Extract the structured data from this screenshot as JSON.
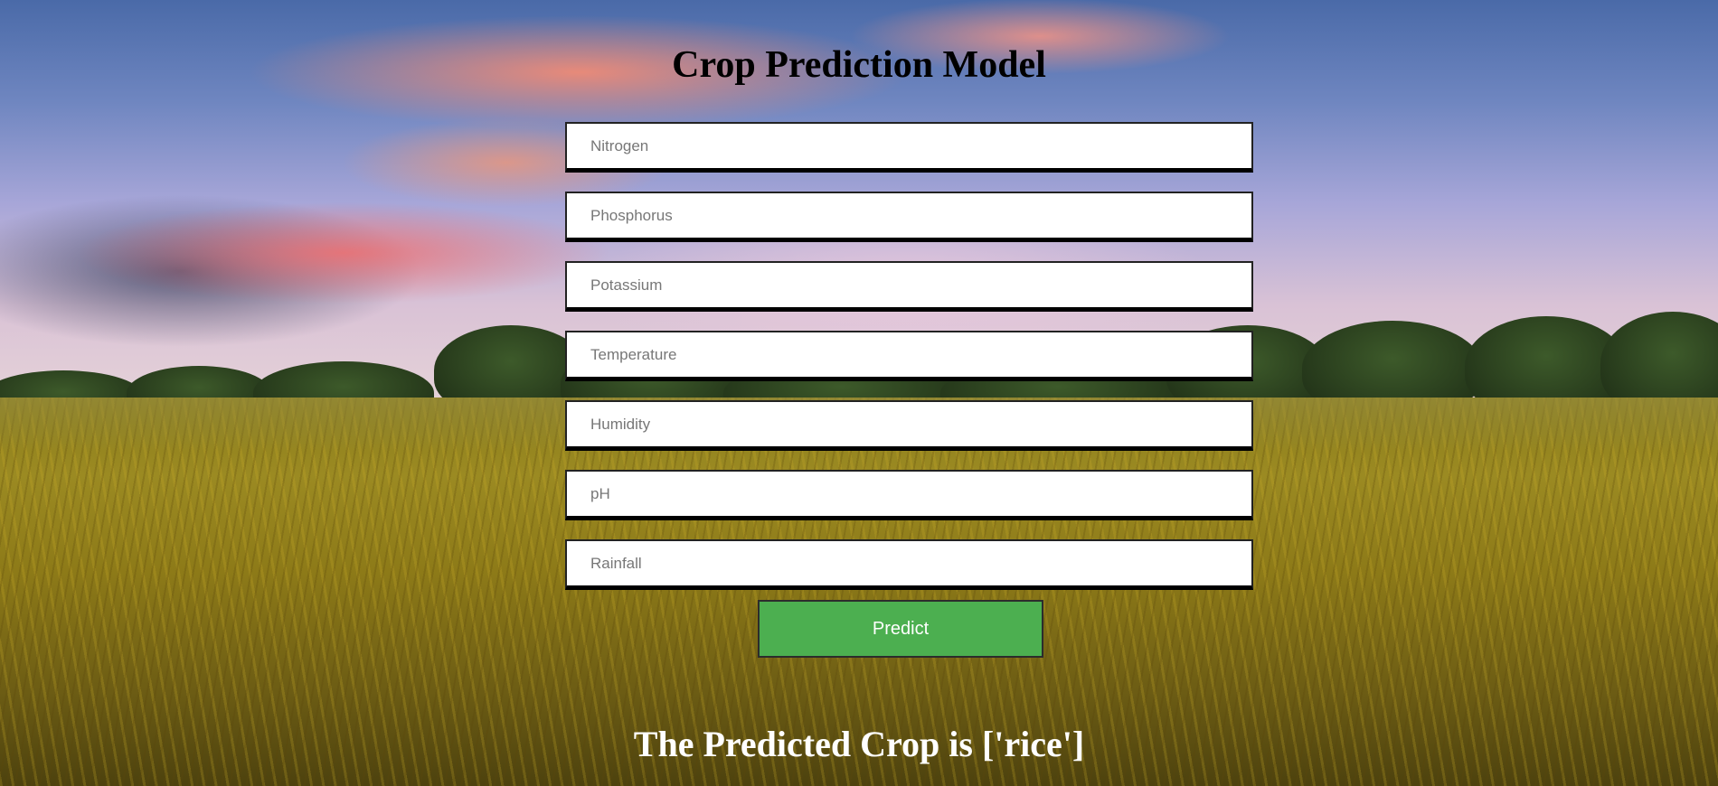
{
  "page": {
    "title": "Crop Prediction Model"
  },
  "form": {
    "fields": [
      {
        "name": "nitrogen-input",
        "placeholder": "Nitrogen",
        "value": ""
      },
      {
        "name": "phosphorus-input",
        "placeholder": "Phosphorus",
        "value": ""
      },
      {
        "name": "potassium-input",
        "placeholder": "Potassium",
        "value": ""
      },
      {
        "name": "temperature-input",
        "placeholder": "Temperature",
        "value": ""
      },
      {
        "name": "humidity-input",
        "placeholder": "Humidity",
        "value": ""
      },
      {
        "name": "ph-input",
        "placeholder": "pH",
        "value": ""
      },
      {
        "name": "rainfall-input",
        "placeholder": "Rainfall",
        "value": ""
      }
    ],
    "submit_label": "Predict"
  },
  "result": {
    "text": "The Predicted Crop is ['rice']"
  },
  "colors": {
    "button_bg": "#4caf50",
    "title_color": "#000000",
    "result_color": "#ffffff"
  }
}
